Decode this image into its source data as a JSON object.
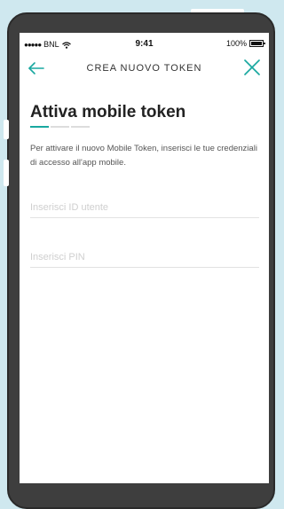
{
  "status_bar": {
    "signal_dots": "●●●●●",
    "carrier": "BNL",
    "time": "9:41",
    "battery_percent": "100%",
    "battery_level": 1.0
  },
  "nav": {
    "title": "CREA NUOVO TOKEN",
    "back_icon": "arrow-left-icon",
    "close_icon": "close-icon"
  },
  "page": {
    "title": "Attiva mobile token",
    "steps_total": 3,
    "steps_active": 1,
    "instructions": "Per attivare il nuovo Mobile Token, inserisci le tue credenziali di accesso all'app mobile."
  },
  "form": {
    "user_id": {
      "value": "",
      "placeholder": "Inserisci ID utente"
    },
    "pin": {
      "value": "",
      "placeholder": "Inserisci PIN"
    }
  },
  "colors": {
    "accent": "#19a8a0",
    "background": "#cfe8ef",
    "phone_frame": "#3e3e3e"
  }
}
